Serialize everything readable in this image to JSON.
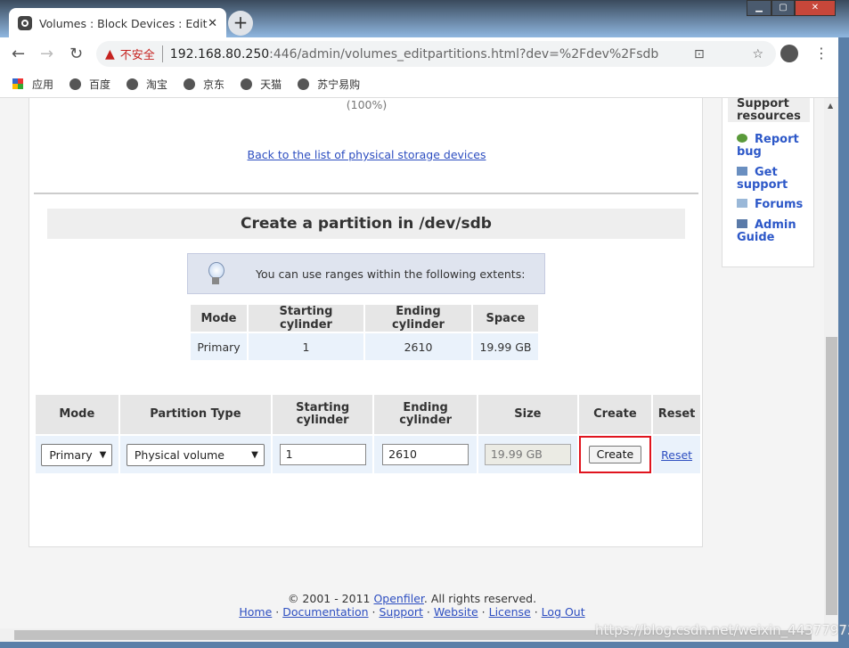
{
  "browser": {
    "tab_title": "Volumes : Block Devices : Edit",
    "insecure_label": "不安全",
    "url_host": "192.168.80.250",
    "url_path": ":446/admin/volumes_editpartitions.html?dev=%2Fdev%2Fsdb",
    "bookmarks": [
      "应用",
      "百度",
      "淘宝",
      "京东",
      "天猫",
      "苏宁易购"
    ]
  },
  "main": {
    "percent": "(100%)",
    "back_link": "Back to the list of physical storage devices",
    "section_title": "Create a partition in /dev/sdb",
    "info_text": "You can use ranges within the following extents:",
    "extents": {
      "headers": [
        "Mode",
        "Starting cylinder",
        "Ending cylinder",
        "Space"
      ],
      "row": [
        "Primary",
        "1",
        "2610",
        "19.99 GB"
      ]
    },
    "form": {
      "headers": [
        "Mode",
        "Partition Type",
        "Starting cylinder",
        "Ending cylinder",
        "Size",
        "Create",
        "Reset"
      ],
      "mode": "Primary",
      "partition_type": "Physical volume",
      "start": "1",
      "end": "2610",
      "size": "19.99 GB",
      "create_label": "Create",
      "reset_label": "Reset"
    }
  },
  "sidebar": {
    "title": "Support resources",
    "items": [
      "Report bug",
      "Get support",
      "Forums",
      "Admin Guide"
    ]
  },
  "footer": {
    "copyright_pre": "© 2001 - 2011 ",
    "brand": "Openfiler",
    "copyright_post": ". All rights reserved.",
    "links": [
      "Home",
      "Documentation",
      "Support",
      "Website",
      "License",
      "Log Out"
    ]
  },
  "watermark": "https://blog.csdn.net/weixin_44377973",
  "colors": {
    "link": "#2d4ec0",
    "highlight": "#e0141e"
  }
}
